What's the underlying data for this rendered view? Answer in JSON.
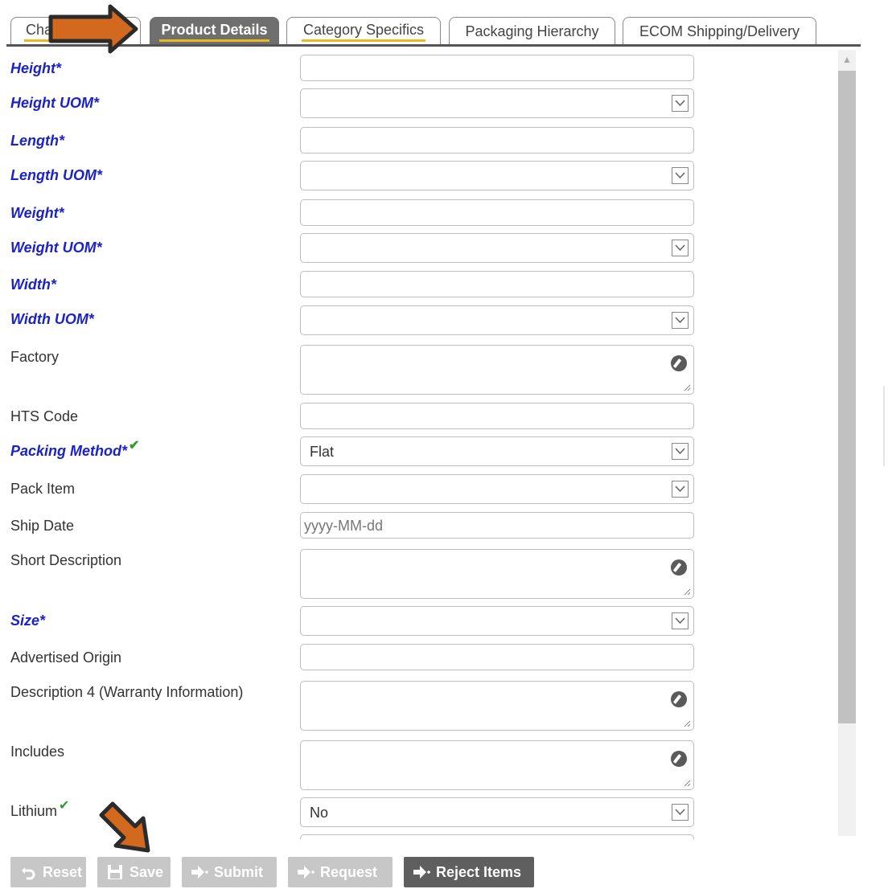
{
  "tabs": [
    {
      "label": "Cha",
      "active": false
    },
    {
      "label": "Product Details",
      "active": true
    },
    {
      "label": "Category Specifics",
      "active": false
    },
    {
      "label": "Packaging Hierarchy",
      "active": false
    },
    {
      "label": "ECOM Shipping/Delivery",
      "active": false
    }
  ],
  "fields": {
    "height": {
      "label": "Height*",
      "value": ""
    },
    "height_uom": {
      "label": "Height UOM*",
      "value": ""
    },
    "length": {
      "label": "Length*",
      "value": ""
    },
    "length_uom": {
      "label": "Length UOM*",
      "value": ""
    },
    "weight": {
      "label": "Weight*",
      "value": ""
    },
    "weight_uom": {
      "label": "Weight UOM*",
      "value": ""
    },
    "width": {
      "label": "Width*",
      "value": ""
    },
    "width_uom": {
      "label": "Width UOM*",
      "value": ""
    },
    "factory": {
      "label": "Factory",
      "value": ""
    },
    "hts_code": {
      "label": "HTS Code",
      "value": ""
    },
    "packing_method": {
      "label": "Packing Method*",
      "value": "Flat"
    },
    "pack_item": {
      "label": "Pack Item",
      "value": ""
    },
    "ship_date": {
      "label": "Ship Date",
      "value": "",
      "placeholder": "yyyy-MM-dd"
    },
    "short_description": {
      "label": "Short Description",
      "value": ""
    },
    "size": {
      "label": "Size*",
      "value": ""
    },
    "advertised_origin": {
      "label": "Advertised Origin",
      "value": ""
    },
    "description4": {
      "label": "Description 4 (Warranty Information)",
      "value": ""
    },
    "includes": {
      "label": "Includes",
      "value": ""
    },
    "lithium": {
      "label": "Lithium",
      "value": "No"
    }
  },
  "buttons": {
    "reset": "Reset",
    "save": "Save",
    "submit": "Submit",
    "request": "Request",
    "reject": "Reject Items"
  },
  "colors": {
    "required_label": "#1a22c8",
    "active_tab": "#6f6f6f",
    "tab_underline": "#e8b923",
    "arrow": "#d2691e",
    "check": "#2e9d2e"
  }
}
